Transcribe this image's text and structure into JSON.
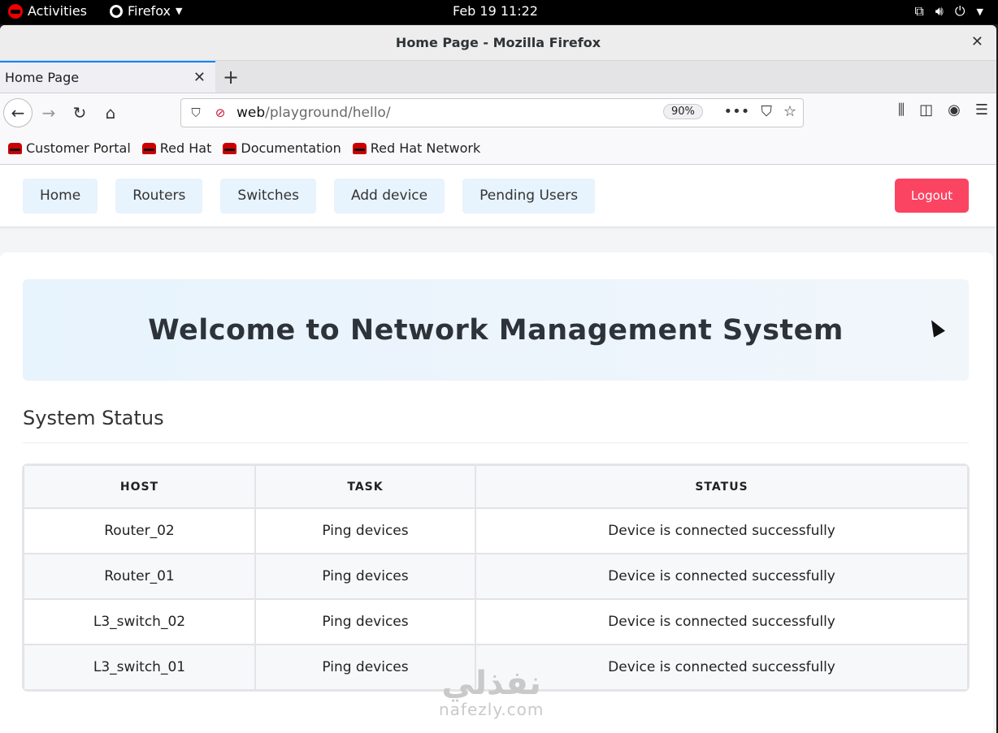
{
  "system_bar": {
    "activities": "Activities",
    "app_name": "Firefox",
    "clock": "Feb 19  11:22"
  },
  "window": {
    "title": "Home Page - Mozilla Firefox"
  },
  "browser": {
    "tab_title": "Home Page",
    "url_host": "web",
    "url_path": "/playground/hello/",
    "zoom": "90%",
    "bookmarks": [
      "Customer Portal",
      "Red Hat",
      "Documentation",
      "Red Hat Network"
    ]
  },
  "app": {
    "nav": [
      "Home",
      "Routers",
      "Switches",
      "Add device",
      "Pending Users"
    ],
    "logout_label": "Logout",
    "hero_title": "Welcome to Network Management System",
    "section_title": "System Status",
    "table": {
      "headers": [
        "HOST",
        "TASK",
        "STATUS"
      ],
      "rows": [
        [
          "Router_02",
          "Ping devices",
          "Device is connected successfully"
        ],
        [
          "Router_01",
          "Ping devices",
          "Device is connected successfully"
        ],
        [
          "L3_switch_02",
          "Ping devices",
          "Device is connected successfully"
        ],
        [
          "L3_switch_01",
          "Ping devices",
          "Device is connected successfully"
        ]
      ]
    }
  },
  "watermark": {
    "arabic": "نفذلي",
    "latin": "nafezly.com"
  },
  "colors": {
    "nav_pill": "#e7f3fd",
    "logout": "#fa4461",
    "tab_accent": "#0a84ff"
  }
}
